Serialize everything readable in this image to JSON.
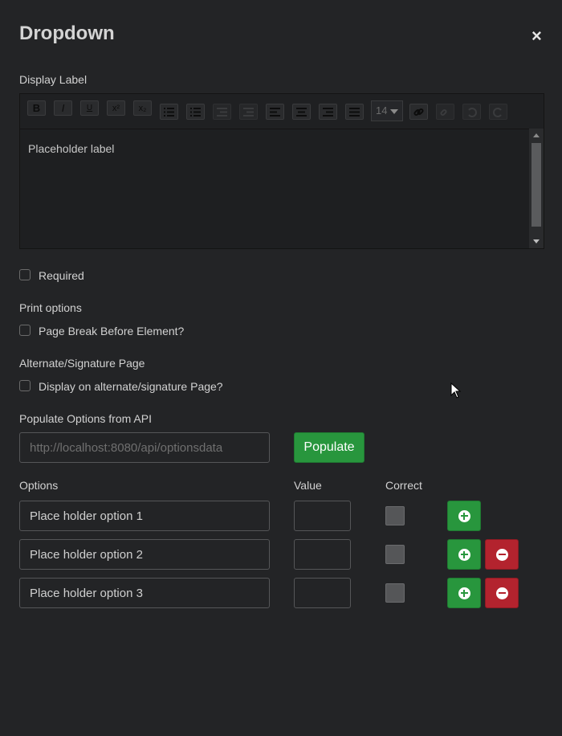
{
  "dialog": {
    "title": "Dropdown",
    "close_label": "×"
  },
  "display_label": {
    "heading": "Display Label",
    "font_size": "14",
    "content": "Placeholder label",
    "toolbar": [
      "bold-icon",
      "italic-icon",
      "underline-icon",
      "superscript-icon",
      "subscript-icon",
      "unordered-list-icon",
      "ordered-list-icon",
      "outdent-icon",
      "indent-icon",
      "align-left-icon",
      "align-center-icon",
      "align-right-icon",
      "align-justify-icon",
      "link-icon",
      "unlink-icon",
      "undo-icon",
      "redo-icon"
    ]
  },
  "required": {
    "label": "Required",
    "checked": false
  },
  "print_options": {
    "heading": "Print options",
    "page_break_label": "Page Break Before Element?",
    "checked": false
  },
  "alternate_page": {
    "heading": "Alternate/Signature Page",
    "display_label": "Display on alternate/signature Page?",
    "checked": false
  },
  "api": {
    "heading": "Populate Options from API",
    "placeholder": "http://localhost:8080/api/optionsdata",
    "button_label": "Populate"
  },
  "options": {
    "headers": {
      "options": "Options",
      "value": "Value",
      "correct": "Correct"
    },
    "rows": [
      {
        "option": "Place holder option 1",
        "value": "",
        "correct": false,
        "removable": false
      },
      {
        "option": "Place holder option 2",
        "value": "",
        "correct": false,
        "removable": true
      },
      {
        "option": "Place holder option 3",
        "value": "",
        "correct": false,
        "removable": true
      }
    ]
  },
  "colors": {
    "background": "#232426",
    "success": "#28963d",
    "danger": "#b3232e"
  }
}
